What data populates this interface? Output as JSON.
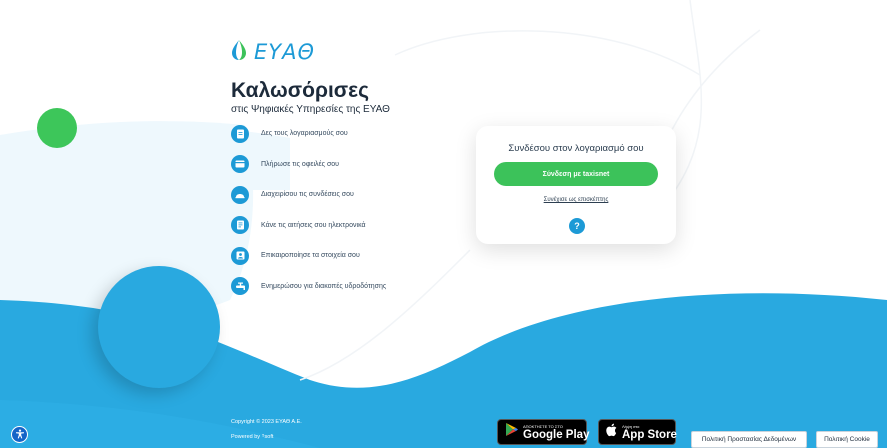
{
  "brand": {
    "name": "ΕΥΑΘ"
  },
  "welcome": {
    "title": "Καλωσόρισες",
    "subtitle": "στις Ψηφιακές Υπηρεσίες της ΕΥΑΘ"
  },
  "features": [
    {
      "label": "Δες τους λογαριασμούς σου",
      "icon": "document-icon"
    },
    {
      "label": "Πλήρωσε τις οφειλές σου",
      "icon": "card-icon"
    },
    {
      "label": "Διαχειρίσου τις συνδέσεις σου",
      "icon": "connection-icon"
    },
    {
      "label": "Κάνε τις αιτήσεις σου ηλεκτρονικά",
      "icon": "form-icon"
    },
    {
      "label": "Επικαιροποίησε τα στοιχεία σου",
      "icon": "profile-icon"
    },
    {
      "label": "Ενημερώσου για διακοπές υδροδότησης",
      "icon": "faucet-icon"
    }
  ],
  "login": {
    "title": "Συνδέσου στον λογαριασμό σου",
    "taxisnet_button": "Σύνδεση με taxisnet",
    "guest_link": "Συνέχισε ως επισκέπτης",
    "help_icon": "?"
  },
  "footer": {
    "copyright": "Copyright © 2023 ΕΥΑΘ Α.Ε.",
    "powered_by": "Powered by",
    "powered_logo": "soft"
  },
  "stores": {
    "google": {
      "small": "ΑΠΟΚΤΗΣΤΕ ΤΟ ΣΤΟ",
      "big": "Google Play"
    },
    "apple": {
      "small": "Λήψη στο",
      "big": "App Store"
    }
  },
  "policies": {
    "privacy": "Πολιτική Προστασίας Δεδομένων",
    "cookie": "Πολιτική Cookie"
  },
  "colors": {
    "primary_blue": "#29a9e0",
    "accent_green": "#3cc25a",
    "dark_text": "#1c2a3a"
  }
}
